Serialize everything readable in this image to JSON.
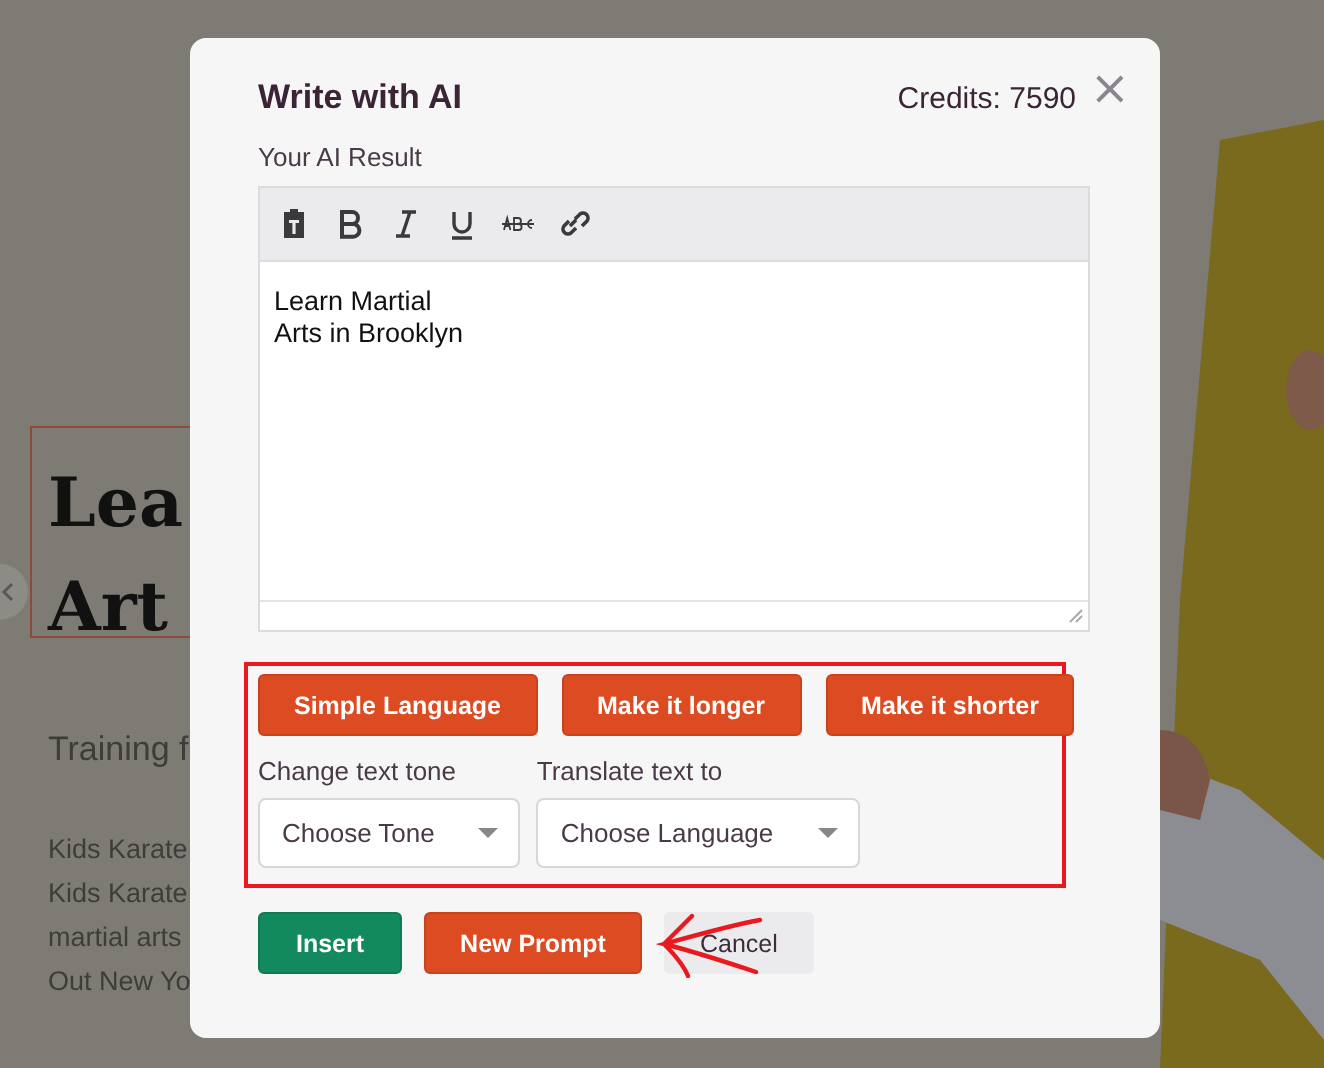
{
  "background_page": {
    "headline_lines": [
      "Lea",
      "Art"
    ],
    "subtitle": "Training f",
    "body_lines": [
      "Kids Karate",
      "Kids Karate",
      "martial arts",
      "Out New Yo"
    ],
    "hero": {
      "kind": "picture"
    }
  },
  "dialog": {
    "title": "Write with AI",
    "credits": "Credits: 7590",
    "close": "×",
    "result_label": "Your AI Result",
    "editor": {
      "tools": [
        {
          "kind": "paste"
        },
        {
          "kind": "bold"
        },
        {
          "kind": "italic"
        },
        {
          "kind": "underline"
        },
        {
          "kind": "strike"
        },
        {
          "kind": "link"
        }
      ],
      "content": "Learn Martial\nArts in Brooklyn"
    },
    "quick_actions": [
      "Simple Language",
      "Make it longer",
      "Make it shorter"
    ],
    "selects": [
      {
        "label": "Change text tone",
        "placeholder": "Choose Tone"
      },
      {
        "label": "Translate text to",
        "placeholder": "Choose Language"
      }
    ],
    "buttons": [
      {
        "label": "Insert",
        "kind": "primary"
      },
      {
        "label": "New Prompt",
        "kind": "accent"
      },
      {
        "label": "Cancel",
        "kind": "secondary"
      }
    ]
  }
}
